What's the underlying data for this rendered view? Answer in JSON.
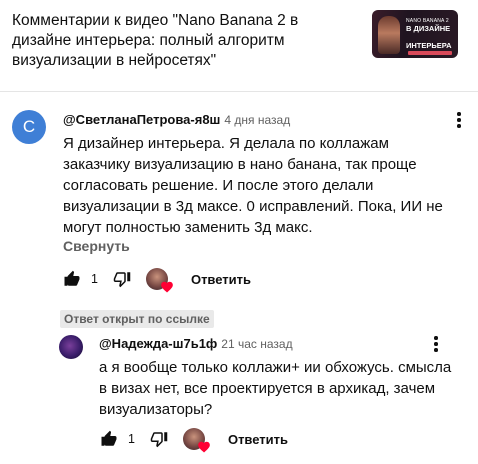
{
  "header": {
    "title": "Комментарии к видео \"Nano Banana 2 в дизайне интерьера: полный алгоритм визуализации в нейросетях\"",
    "thumbnail": {
      "line1": "NANO BANANA 2",
      "line2a": "В ДИЗАЙНЕ",
      "line2b": "ИНТЕРЬЕРА"
    }
  },
  "comment": {
    "avatar_letter": "С",
    "avatar_color": "#3f7fd6",
    "author": "@СветланаПетрова-я8ш",
    "time": "4 дня назад",
    "text": "Я дизайнер интерьера. Я делала по коллажам заказчику визуализацию в нано банана, так проще согласовать решение. И после этого делали визуализации в 3д максе. 0 исправлений. Пока, ИИ не могут полностью заменить 3д макс.",
    "collapse_label": "Свернуть",
    "like_count": "1",
    "reply_label": "Ответить"
  },
  "reply_section": {
    "badge": "Ответ открыт по ссылке",
    "reply": {
      "author": "@Надежда-ш7ь1ф",
      "time": "21 час назад",
      "text": "а я вообще только коллажи+ ии обхожусь. смысла в визах нет, все проектируется в архикад, зачем визуализаторы?",
      "like_count": "1",
      "reply_label": "Ответить"
    }
  },
  "colors": {
    "heart": "#ff0033",
    "secondary_text": "#606060"
  },
  "icons": [
    "like-icon",
    "dislike-icon",
    "more-vert-icon",
    "creator-heart-icon"
  ]
}
